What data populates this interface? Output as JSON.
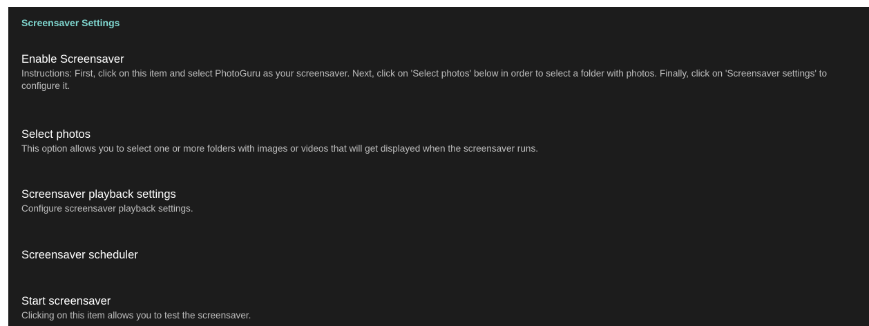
{
  "category": {
    "title": "Screensaver Settings"
  },
  "items": [
    {
      "title": "Enable Screensaver",
      "summary": "Instructions: First, click on this item and select PhotoGuru as your screensaver. Next, click on 'Select photos' below in order to select a folder with photos. Finally, click on 'Screensaver settings' to configure it."
    },
    {
      "title": "Select photos",
      "summary": "This option allows you to select one or more folders with images or videos that will get displayed when the screensaver runs."
    },
    {
      "title": "Screensaver playback settings",
      "summary": "Configure screensaver playback settings."
    },
    {
      "title": "Screensaver scheduler",
      "summary": ""
    },
    {
      "title": "Start screensaver",
      "summary": "Clicking on this item allows you to test the screensaver."
    }
  ],
  "colors": {
    "background": "#1c1c1c",
    "accent": "#7fd6cf",
    "title_text": "#ffffff",
    "summary_text": "#bdbdbd"
  }
}
